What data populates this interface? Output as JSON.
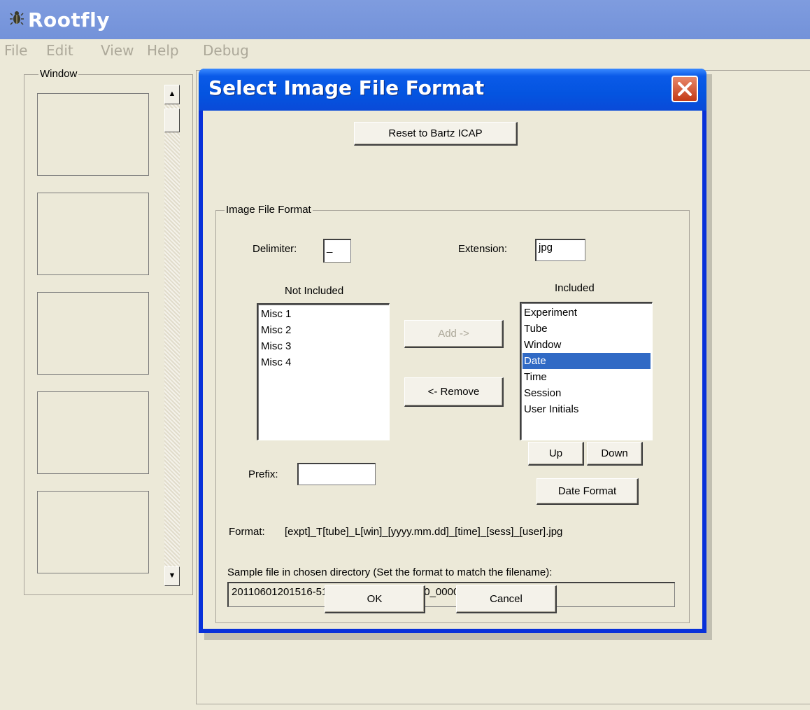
{
  "app": {
    "title": "Rootfly",
    "icon": "beetle-icon"
  },
  "menu": [
    "File",
    "Edit",
    "View",
    "Help",
    "Debug"
  ],
  "window_panel": {
    "legend": "Window",
    "scroll_up_icon": "scroll-up-arrow-icon",
    "scroll_down_icon": "scroll-down-arrow-icon"
  },
  "dialog": {
    "title": "Select Image File Format",
    "close_icon": "close-icon",
    "reset_label": "Reset to Bartz ICAP",
    "group_legend": "Image File Format",
    "delimiter_label": "Delimiter:",
    "delimiter_value": "_",
    "extension_label": "Extension:",
    "extension_value": "jpg",
    "not_included_label": "Not Included",
    "not_included_items": [
      "Misc 1",
      "Misc 2",
      "Misc 3",
      "Misc 4"
    ],
    "included_label": "Included",
    "included_items": [
      "Experiment",
      "Tube",
      "Window",
      "Date",
      "Time",
      "Session",
      "User Initials"
    ],
    "selected_included": "Date",
    "add_label": "Add ->",
    "remove_label": "<- Remove",
    "up_label": "Up",
    "down_label": "Down",
    "date_format_label": "Date Format",
    "prefix_label": "Prefix:",
    "prefix_value": "",
    "format_label": "Format:",
    "format_value": "[expt]_T[tube]_L[win]_[yyyy.mm.dd]_[time]_[sess]_[user].jpg",
    "sample_label": "Sample file in chosen directory (Set the format to match the filename):",
    "sample_value": "20110601201516-5111-139384-0271-2170_000001.jpg",
    "ok_label": "OK",
    "cancel_label": "Cancel"
  },
  "colors": {
    "titlebar": "#7392d9",
    "dialog_titlebar": "#0454e0",
    "selection": "#316ac5",
    "face": "#ece9d8"
  }
}
